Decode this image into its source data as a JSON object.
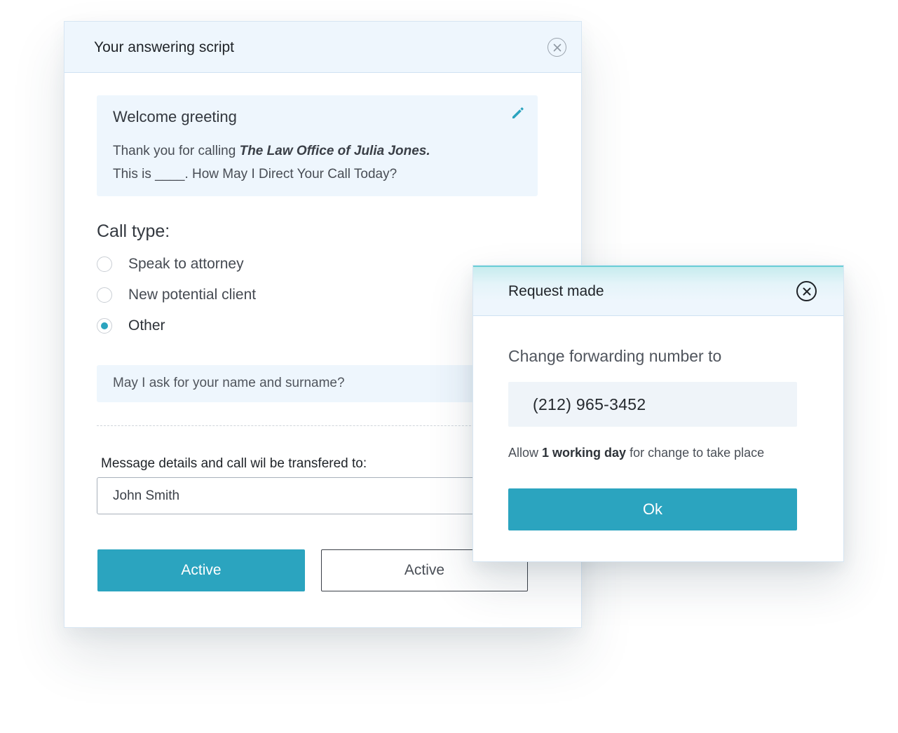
{
  "script_panel": {
    "title": "Your answering script",
    "greeting": {
      "title": "Welcome greeting",
      "line1_prefix": "Thank you for calling ",
      "line1_business": "The Law Office of Julia Jones.",
      "line2": "This is ____. How May I Direct Your Call Today?"
    },
    "call_type": {
      "heading": "Call type:",
      "options": [
        {
          "label": "Speak to attorney",
          "selected": false
        },
        {
          "label": "New potential client",
          "selected": false
        },
        {
          "label": "Other",
          "selected": true
        }
      ]
    },
    "question": "May I ask for your name and surname?",
    "transfer_label": "Message details and call wil  be transfered to:",
    "transfer_value": "John Smith",
    "buttons": {
      "primary": "Active",
      "secondary": "Active"
    }
  },
  "request_modal": {
    "title": "Request made",
    "subtitle": "Change forwarding number to",
    "phone": "(212) 965-3452",
    "note_prefix": "Allow ",
    "note_bold": "1 working day",
    "note_suffix": " for change to take place",
    "ok_label": "Ok"
  },
  "colors": {
    "accent": "#2ba4bf",
    "header_bg": "#eef6fd",
    "text_dark": "#1f2328"
  },
  "icons": [
    "close-icon",
    "pencil-edit-icon",
    "radio-icon"
  ]
}
